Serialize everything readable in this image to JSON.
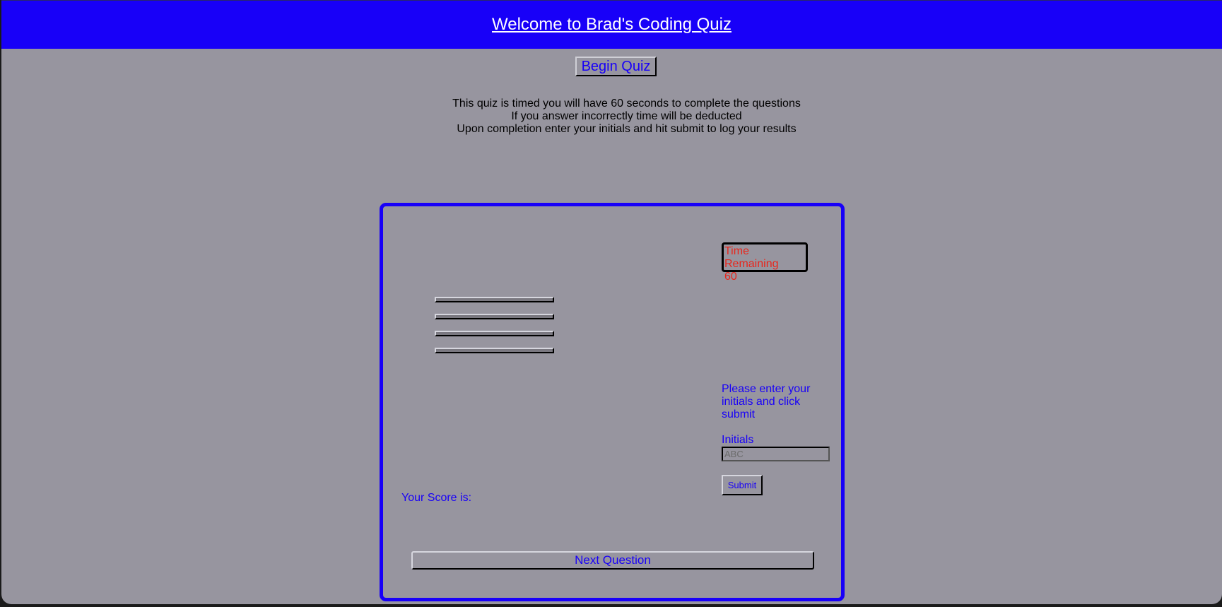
{
  "header": {
    "title": "Welcome to Brad's Coding Quiz"
  },
  "begin_button": {
    "label": "Begin Quiz"
  },
  "instructions": [
    "This quiz is timed you will have 60 seconds to complete the questions",
    "If you answer incorrectly time will be deducted",
    "Upon completion enter your initials and hit submit to log your results"
  ],
  "quiz": {
    "timer": {
      "label": "Time Remaining",
      "value": "60"
    },
    "answers": [
      "",
      "",
      "",
      ""
    ],
    "submit_form": {
      "prompt": "Please enter your initials and click submit",
      "initials_label": "Initials",
      "initials_placeholder": "ABC",
      "submit_label": "Submit"
    },
    "score_label": "Your Score is:",
    "next_button_label": "Next Question"
  },
  "colors": {
    "header_bg": "#1800f8",
    "page_bg": "#97959f",
    "accent": "#1800f8",
    "timer_text": "#e8261c"
  }
}
